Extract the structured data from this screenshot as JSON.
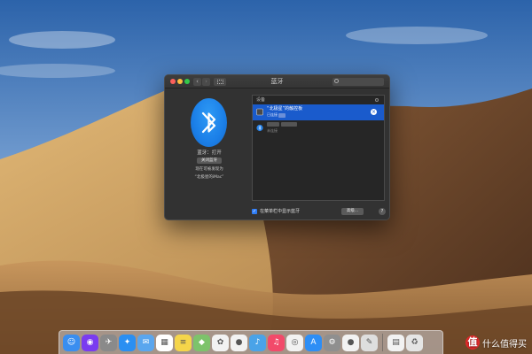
{
  "window": {
    "title": "蓝牙",
    "search_placeholder": ""
  },
  "bluetooth": {
    "status": "蓝牙：打开",
    "toggle_button": "关闭蓝牙",
    "discoverable_as": "现在可被发现为",
    "computer_name": "“北极星的iMac”"
  },
  "devices": {
    "header": "设备",
    "items": [
      {
        "name": "“北极星”的触控板",
        "status": "已连接",
        "selected": true
      },
      {
        "name": "",
        "status": "未连接",
        "selected": false
      }
    ]
  },
  "footer": {
    "show_in_menubar": "在菜单栏中显示蓝牙",
    "show_in_menubar_checked": true,
    "advanced_button": "高级...",
    "help_button": "?"
  },
  "dock": {
    "items": [
      {
        "icon": "finder-icon",
        "color": "#3a8ef0"
      },
      {
        "icon": "siri-icon",
        "color": "#7a3cf0"
      },
      {
        "icon": "launchpad-icon",
        "color": "#8a8a8a"
      },
      {
        "icon": "safari-icon",
        "color": "#2a8ff2"
      },
      {
        "icon": "mail-icon",
        "color": "#5aa6ee"
      },
      {
        "icon": "calendar-icon",
        "color": "#ffffff"
      },
      {
        "icon": "notes-icon",
        "color": "#f5d54a"
      },
      {
        "icon": "maps-icon",
        "color": "#7dc36b"
      },
      {
        "icon": "photos-icon",
        "color": "#f2f2f2"
      },
      {
        "icon": "qq-icon",
        "color": "#f2f2f2"
      },
      {
        "icon": "tweetbot-icon",
        "color": "#4aa3e8"
      },
      {
        "icon": "music-icon",
        "color": "#f24a6a"
      },
      {
        "icon": "chrome-icon",
        "color": "#f2f2f2"
      },
      {
        "icon": "app-store-icon",
        "color": "#2d8ef5"
      },
      {
        "icon": "system-preferences-icon",
        "color": "#8f8f8f"
      },
      {
        "icon": "qq-icon",
        "color": "#f2f2f2"
      },
      {
        "icon": "script-editor-icon",
        "color": "#dedede"
      },
      {
        "icon": "document-icon",
        "color": "#f2f2f2"
      },
      {
        "icon": "trash-icon",
        "color": "#e5e5e5"
      }
    ]
  },
  "watermark": {
    "logo": "值",
    "text": "什么值得买"
  }
}
